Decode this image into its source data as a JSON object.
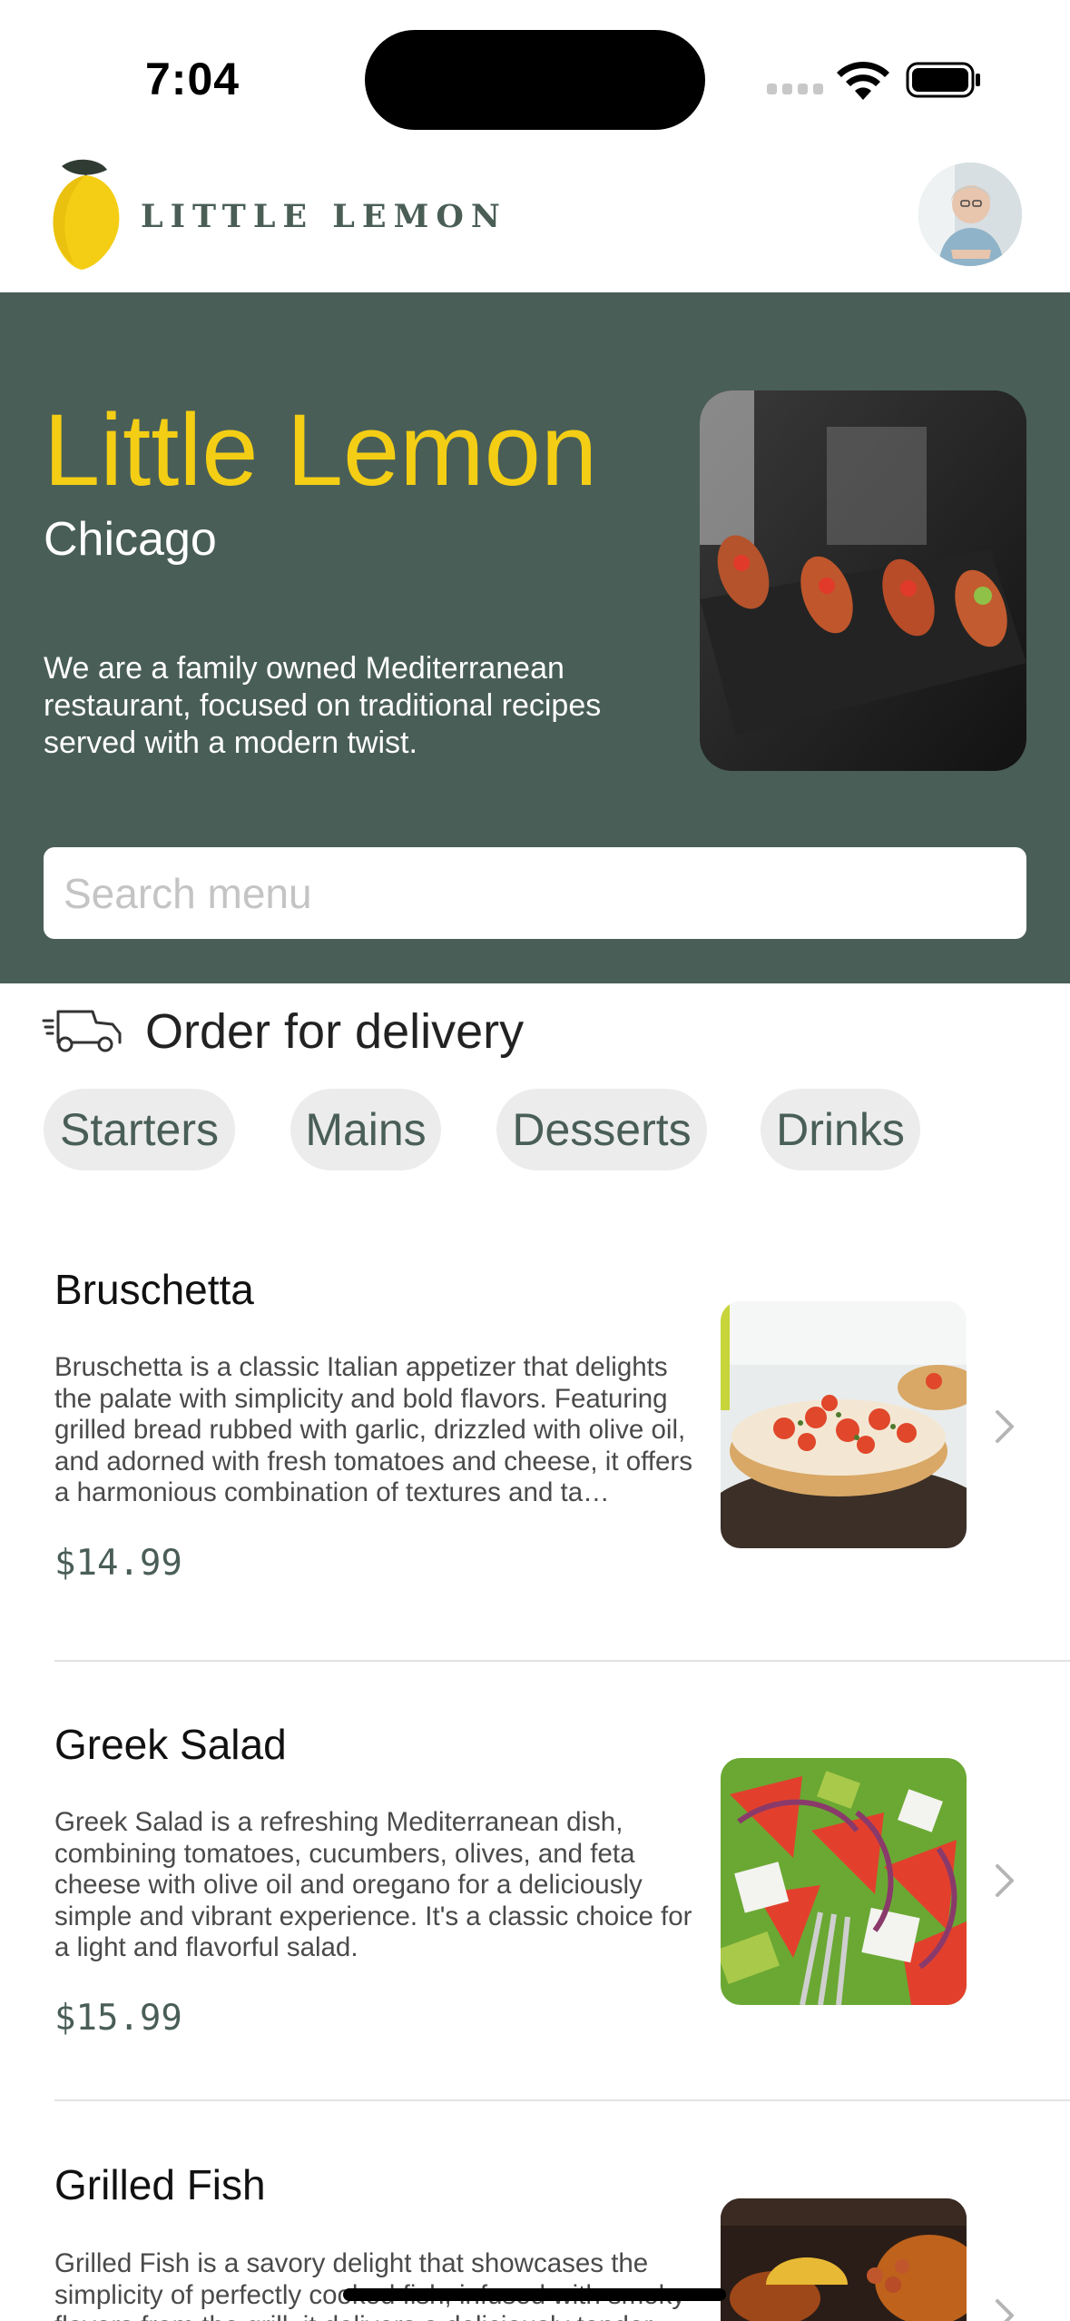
{
  "status_bar": {
    "time": "7:04",
    "icons": [
      "cellular-signal-icon",
      "wifi-icon",
      "battery-icon"
    ]
  },
  "header": {
    "logo_text": "LITTLE LEMON",
    "logo_icon": "lemon-icon",
    "avatar": "profile-avatar"
  },
  "hero": {
    "title": "Little Lemon",
    "city": "Chicago",
    "description": "We are a family owned Mediterranean restaurant, focused on traditional recipes served with a modern twist.",
    "image": "bruschetta-serving-photo",
    "search_placeholder": "Search menu",
    "search_value": ""
  },
  "delivery": {
    "icon": "delivery-truck-icon",
    "title": "Order for delivery",
    "categories": [
      "Starters",
      "Mains",
      "Desserts",
      "Drinks"
    ]
  },
  "menu": {
    "items": [
      {
        "name": "Bruschetta",
        "description": "Bruschetta is a classic Italian appetizer that delights the palate with simplicity and bold flavors. Featuring grilled bread rubbed with garlic, drizzled with olive oil, and adorned with fresh tomatoes and cheese, it offers a harmonious combination of textures and ta…",
        "price": "$14.99",
        "image": "bruschetta-photo"
      },
      {
        "name": "Greek Salad",
        "description": "Greek Salad is a refreshing Mediterranean dish, combining tomatoes, cucumbers, olives, and feta cheese with olive oil and oregano for a deliciously simple and vibrant experience. It's a classic choice for a light and flavorful salad.",
        "price": "$15.99",
        "image": "greek-salad-photo"
      },
      {
        "name": "Grilled Fish",
        "description": "Grilled Fish is a savory delight that showcases the simplicity of perfectly cooked fish, infused with smoky flavors from the grill, it delivers a deliciously tender",
        "price": "",
        "image": "grilled-fish-photo"
      }
    ]
  },
  "colors": {
    "primary_green": "#495e57",
    "primary_yellow": "#f4ce14",
    "chip_background": "#ececec"
  }
}
